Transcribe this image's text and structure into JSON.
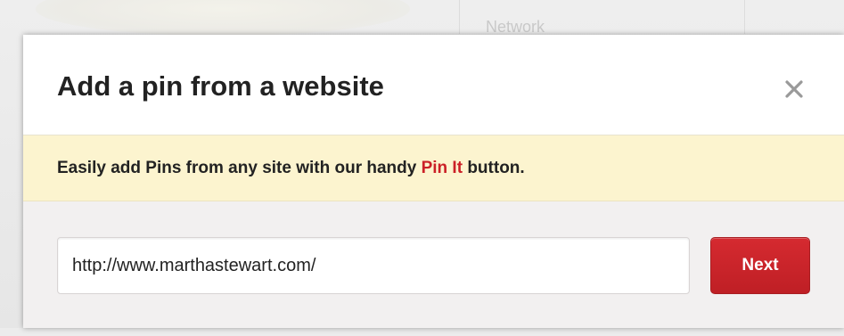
{
  "background": {
    "partial_text": "Network"
  },
  "modal": {
    "title": "Add a pin from a website",
    "close_icon": "close-icon",
    "banner": {
      "text_before": "Easily add Pins from any site with our handy ",
      "link_label": "Pin It",
      "text_after": " button."
    },
    "url_input": {
      "value": "http://www.marthastewart.com/",
      "placeholder": ""
    },
    "next_button": {
      "label": "Next"
    }
  },
  "colors": {
    "brand_red": "#cb2027",
    "banner_bg": "#fcf4cf",
    "form_bg": "#f2f0f0"
  }
}
